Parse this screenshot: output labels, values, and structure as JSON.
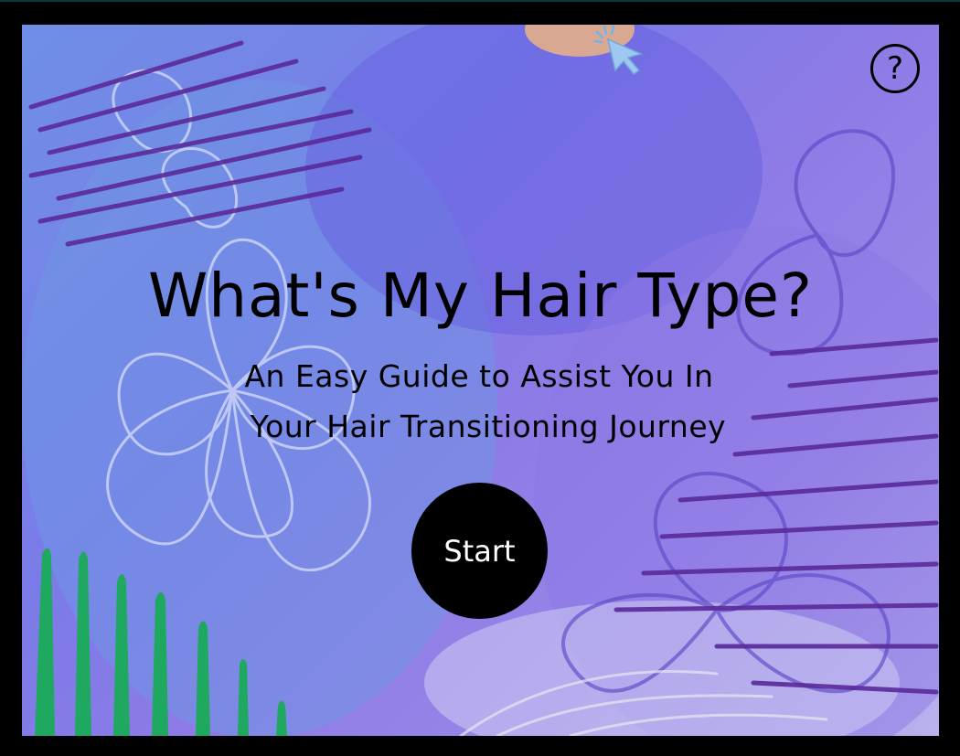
{
  "title": "What's My Hair Type?",
  "subtitle": {
    "line1": "An Easy Guide to Assist You In",
    "line2": "Your Hair Transitioning Journey"
  },
  "start_button": {
    "label": "Start"
  },
  "help_button": {
    "label": "?",
    "icon": "question-circle-icon"
  },
  "cursor": {
    "icon": "pointer-cursor-icon",
    "color": "#9ec8f0"
  },
  "colors": {
    "accent": "#000000",
    "background_purple": "#7a7be8",
    "glitter_purple": "#5a2a9a",
    "glitter_green": "#1fa860"
  }
}
